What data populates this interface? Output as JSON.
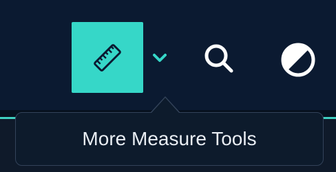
{
  "toolbar": {
    "measure_icon": "ruler-icon",
    "dropdown_icon": "chevron-down-icon",
    "search_icon": "search-icon",
    "contrast_icon": "contrast-icon"
  },
  "tooltip": {
    "text": "More Measure Tools"
  },
  "colors": {
    "toolbar_bg": "#0b1a31",
    "accent": "#36d7c8",
    "tooltip_bg": "#0d1b2c",
    "icon_color": "#ffffff"
  }
}
